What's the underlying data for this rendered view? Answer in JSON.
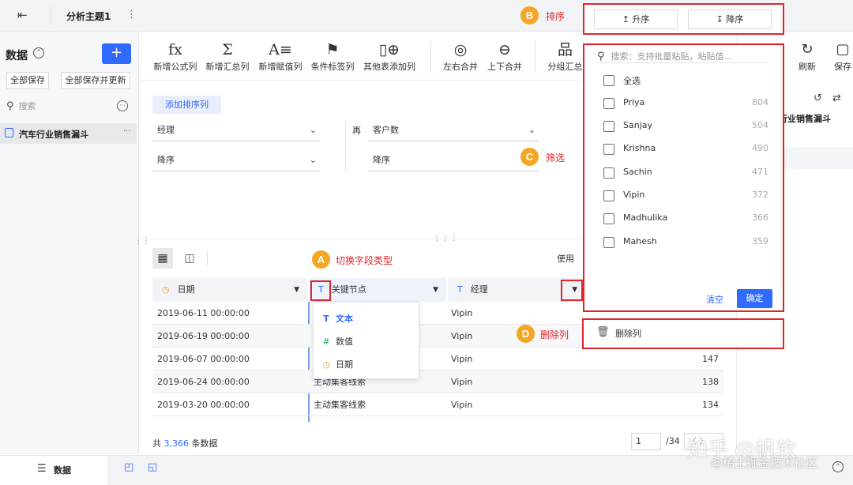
{
  "topbar": {
    "back_icon": "exit-icon",
    "title": "分析主题1",
    "menu_glyph": "⋮"
  },
  "sidebar": {
    "title": "数据",
    "add_glyph": "+",
    "save_all": "全部保存",
    "save_all_update": "全部保存并更新",
    "search_placeholder": "搜索",
    "item_label": "汽车行业销售漏斗",
    "item_more": "···"
  },
  "toolbar": {
    "items": [
      {
        "icon": "fx",
        "label": "新增公式列"
      },
      {
        "icon": "Σ",
        "label": "新增汇总列"
      },
      {
        "icon": "A≡",
        "label": "新增赋值列"
      },
      {
        "icon": "⚑",
        "label": "条件标签列"
      },
      {
        "icon": "▯⊕",
        "label": "其他表添加列"
      },
      {
        "icon": "◎",
        "label": "左右合并"
      },
      {
        "icon": "⊖",
        "label": "上下合并"
      },
      {
        "icon": "品",
        "label": "分组汇总"
      }
    ],
    "right_items": [
      {
        "icon": "↻",
        "label": "刷新"
      },
      {
        "icon": "▢",
        "label": "保存"
      }
    ]
  },
  "sort_config": {
    "add_sort_label": "添加排序列",
    "then_label": "再",
    "first_field": "经理",
    "first_order": "降序",
    "second_field": "客户数",
    "second_order": "降序",
    "dropdown_arrow": "⌄"
  },
  "view": {
    "grid_icon": "▦",
    "layout_icon": "◫",
    "use_label": "使用"
  },
  "table": {
    "columns": [
      {
        "type_icon": "◷",
        "name": "日期"
      },
      {
        "type_icon": "T",
        "name": "关键节点"
      },
      {
        "type_icon": "T",
        "name": "经理"
      }
    ],
    "dropdown_glyph": "▼",
    "rows": [
      {
        "date": "2019-06-11 00:00:00",
        "node": "",
        "manager": "Vipin",
        "value": ""
      },
      {
        "date": "2019-06-19 00:00:00",
        "node": "",
        "manager": "Vipin",
        "value": ""
      },
      {
        "date": "2019-06-07 00:00:00",
        "node": "",
        "manager": "Vipin",
        "value": "147"
      },
      {
        "date": "2019-06-24 00:00:00",
        "node": "主动集客线索",
        "manager": "Vipin",
        "value": "138"
      },
      {
        "date": "2019-03-20 00:00:00",
        "node": "主动集客线索",
        "manager": "Vipin",
        "value": "134"
      }
    ]
  },
  "type_dropdown": {
    "items": [
      {
        "glyph": "T",
        "label": "文本"
      },
      {
        "glyph": "#",
        "label": "数值"
      },
      {
        "glyph": "◷",
        "label": "日期"
      }
    ]
  },
  "footer": {
    "count_prefix": "共",
    "count": "3,366",
    "count_suffix": "条数据",
    "page": "1",
    "page_total": "/34",
    "page_nav": "〈 〉"
  },
  "bottombar": {
    "tab_label": "数据",
    "tab_icon": "☰"
  },
  "right_panel": {
    "title": "行业销售漏斗"
  },
  "sort_popup": {
    "asc": "升序",
    "desc": "降序",
    "asc_icon": "↥",
    "desc_icon": "↧"
  },
  "filter_popup": {
    "search_placeholder": "搜索：支持批量粘贴，粘贴值...",
    "select_all": "全选",
    "items": [
      {
        "name": "Priya",
        "count": "804"
      },
      {
        "name": "Sanjay",
        "count": "504"
      },
      {
        "name": "Krishna",
        "count": "490"
      },
      {
        "name": "Sachin",
        "count": "471"
      },
      {
        "name": "Vipin",
        "count": "372"
      },
      {
        "name": "Madhulika",
        "count": "366"
      },
      {
        "name": "Mahesh",
        "count": "359"
      }
    ],
    "clear": "清空",
    "confirm": "确定"
  },
  "delete_popup": {
    "label": "删除列"
  },
  "annotations": {
    "A": {
      "letter": "A",
      "text": "切换字段类型"
    },
    "B": {
      "letter": "B",
      "text": "排序"
    },
    "C": {
      "letter": "C",
      "text": "筛选"
    },
    "D": {
      "letter": "D",
      "text": "删除列"
    }
  },
  "watermark": {
    "line1": "知乎 @帆软",
    "line2": "@稀土掘金技术社区"
  },
  "colors": {
    "accent": "#2f6bff",
    "annotation_red": "#e0252a",
    "annotation_orange": "#f5a623"
  }
}
